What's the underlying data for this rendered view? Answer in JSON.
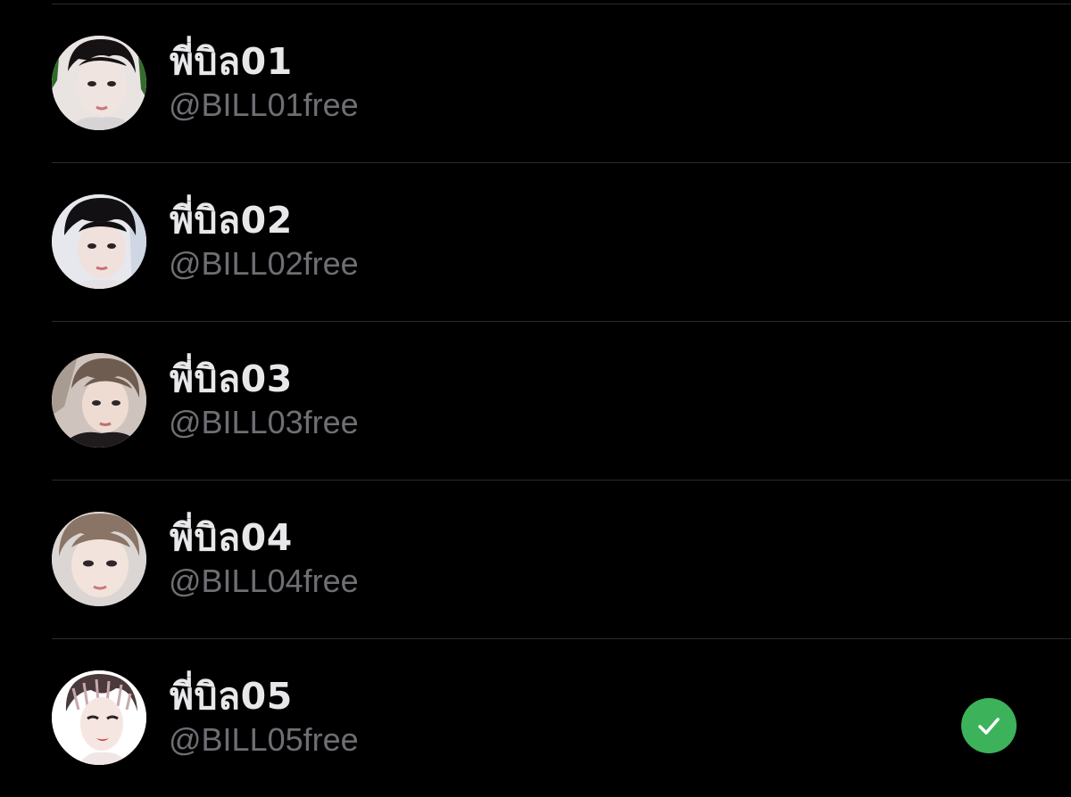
{
  "accounts": [
    {
      "name": "พี่บิล01",
      "handle": "@BILL01free",
      "avatar_icon": "profile-photo",
      "selected": false
    },
    {
      "name": "พี่บิล02",
      "handle": "@BILL02free",
      "avatar_icon": "profile-photo",
      "selected": false
    },
    {
      "name": "พี่บิล03",
      "handle": "@BILL03free",
      "avatar_icon": "profile-photo",
      "selected": false
    },
    {
      "name": "พี่บิล04",
      "handle": "@BILL04free",
      "avatar_icon": "profile-photo",
      "selected": false
    },
    {
      "name": "พี่บิล05",
      "handle": "@BILL05free",
      "avatar_icon": "profile-photo",
      "selected": true
    }
  ],
  "colors": {
    "background": "#000000",
    "name_text": "#e8e8ea",
    "handle_text": "#6e6e74",
    "divider": "#2b2b2e",
    "selected_check": "#3cb25a"
  },
  "selected_indicator_icon": "checkmark-circle-icon"
}
